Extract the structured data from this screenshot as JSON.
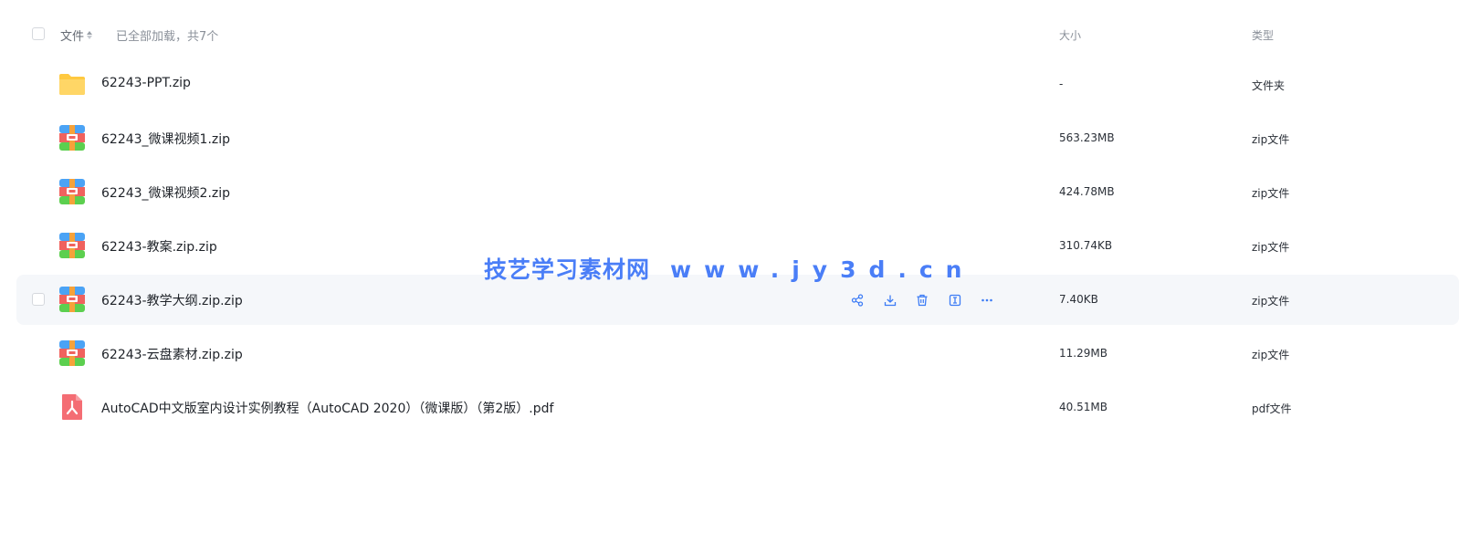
{
  "header": {
    "file_label": "文件",
    "loaded_text": "已全部加载，共7个",
    "size_label": "大小",
    "type_label": "类型"
  },
  "rows": [
    {
      "icon": "folder-icon",
      "name": "62243-PPT.zip",
      "size": "-",
      "type": "文件夹"
    },
    {
      "icon": "zip-icon",
      "name": "62243_微课视频1.zip",
      "size": "563.23MB",
      "type": "zip文件"
    },
    {
      "icon": "zip-icon",
      "name": "62243_微课视频2.zip",
      "size": "424.78MB",
      "type": "zip文件"
    },
    {
      "icon": "zip-icon",
      "name": "62243-教案.zip.zip",
      "size": "310.74KB",
      "type": "zip文件"
    },
    {
      "icon": "zip-icon",
      "name": "62243-教学大纲.zip.zip",
      "size": "7.40KB",
      "type": "zip文件"
    },
    {
      "icon": "zip-icon",
      "name": "62243-云盘素材.zip.zip",
      "size": "11.29MB",
      "type": "zip文件"
    },
    {
      "icon": "pdf-icon",
      "name": "AutoCAD中文版室内设计实例教程（AutoCAD 2020）（微课版）（第2版）.pdf",
      "size": "40.51MB",
      "type": "pdf文件"
    }
  ],
  "hover_actions": [
    "share-icon",
    "download-icon",
    "delete-icon",
    "rename-icon",
    "more-icon"
  ],
  "watermark": {
    "cn": "技艺学习素材网",
    "url": "www.jy3d.cn"
  },
  "colors": {
    "accent": "#3d7cf5",
    "hover_bg": "#f5f7fa",
    "folder": "#ffc940",
    "pdf": "#f46d74"
  }
}
